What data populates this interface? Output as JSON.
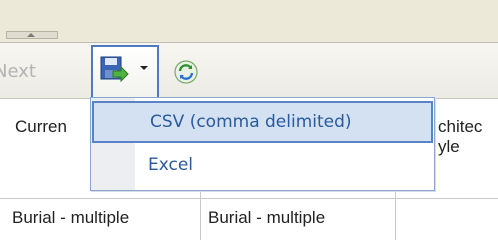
{
  "toolbar": {
    "next_label": "Next"
  },
  "export_menu": {
    "items": [
      {
        "label": "CSV (comma delimited)"
      },
      {
        "label": "Excel"
      }
    ]
  },
  "table": {
    "header_left": "Curren",
    "header_right_1": "chitec",
    "header_right_2": "yle",
    "row1": [
      "Burial - multiple",
      "Burial - multiple"
    ]
  },
  "colors": {
    "accent": "#4f7ac0",
    "menu_text": "#2a5a9c",
    "highlight": "#d3e1f3"
  }
}
